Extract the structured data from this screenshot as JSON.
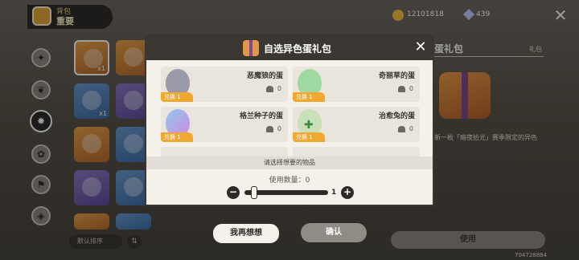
{
  "bag": {
    "title": "背包",
    "category": "重要"
  },
  "categories": [
    "star-icon",
    "leaf-icon",
    "feather-icon",
    "badge-icon",
    "flag-icon",
    "box-icon",
    "paw-icon",
    "sun-icon"
  ],
  "grid_items": [
    {
      "qty": "x1"
    },
    {
      "qty": "x1"
    }
  ],
  "sort_label": "默认排序",
  "currency": {
    "coins": "12101818",
    "gems": "439"
  },
  "detail": {
    "title": "蛋礼包",
    "tag": "礼包",
    "description": "新一枚「暗夜拾光」赛季限定的异色",
    "use_label": "使用",
    "uid": "704728884"
  },
  "dialog": {
    "title": "自选异色蛋礼包",
    "options": [
      {
        "name": "恶魔狼的蛋",
        "exchange": "兑换 1",
        "owned": "0",
        "color": "#9a9aa8"
      },
      {
        "name": "奇丽草的蛋",
        "exchange": "兑换 1",
        "owned": "0",
        "color": "#9fd9a0"
      },
      {
        "name": "格兰种子的蛋",
        "exchange": "兑换 1",
        "owned": "0",
        "color": "#b59ae0"
      },
      {
        "name": "治愈兔的蛋",
        "exchange": "兑换 1",
        "owned": "0",
        "color": "#c9e0b8"
      }
    ],
    "hint": "请选择想要的物品",
    "use_count_label": "使用数量：",
    "use_count_value": "0",
    "slider_max": "1",
    "slider_value": 0,
    "cancel_label": "我再想想",
    "confirm_label": "确认"
  }
}
